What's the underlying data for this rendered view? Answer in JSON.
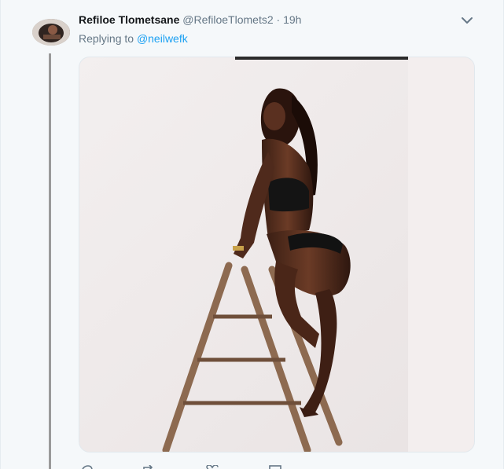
{
  "tweet": {
    "display_name": "Refiloe Tlometsane",
    "handle": "@RefiloeTlomets2",
    "separator": "·",
    "timestamp": "19h",
    "replying_prefix": "Replying to",
    "replying_to": "@neilwefk"
  },
  "icons": {
    "menu": "chevron-down-icon",
    "reply": "reply-icon",
    "retweet": "retweet-icon",
    "like": "heart-icon",
    "dm": "message-icon"
  },
  "colors": {
    "background": "#f5f8fa",
    "link": "#1da1f2",
    "muted": "#657786",
    "name": "#14171a"
  }
}
